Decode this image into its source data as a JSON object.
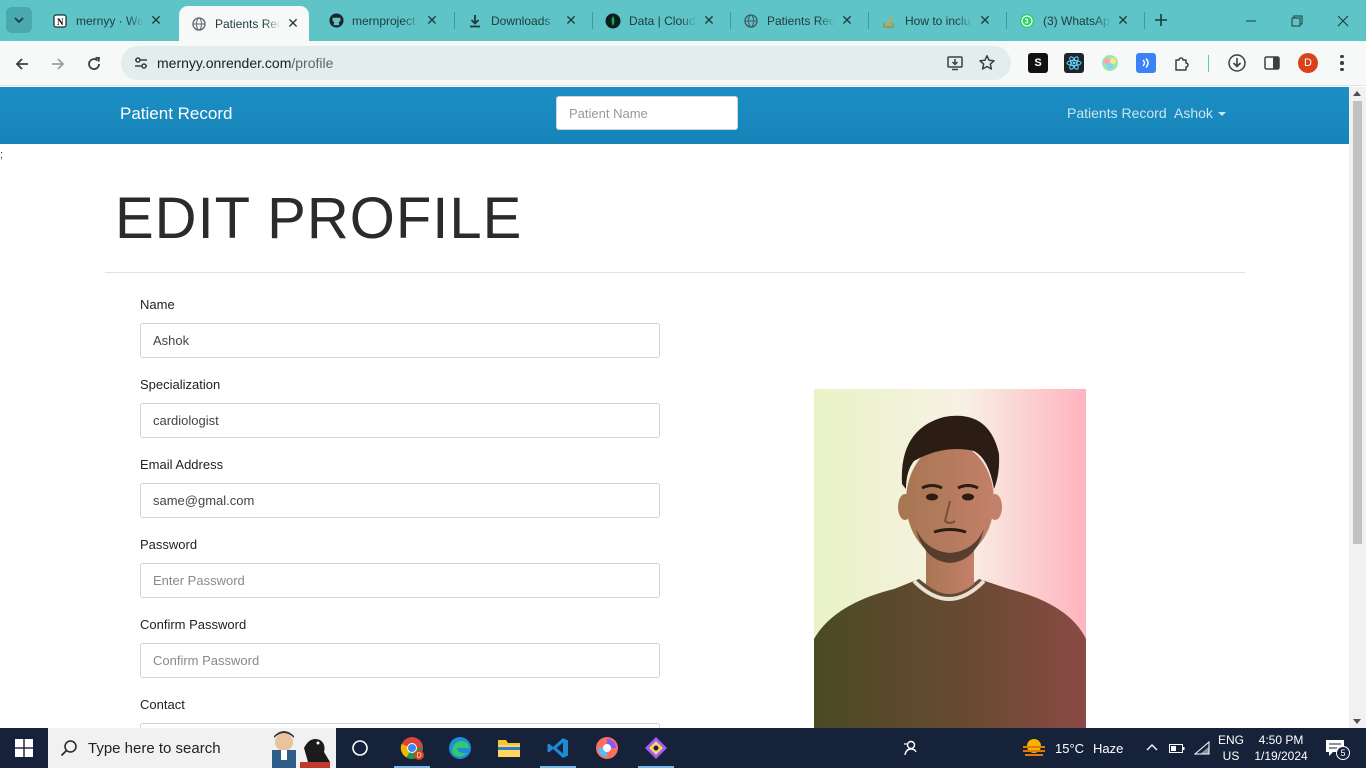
{
  "browser": {
    "tabs": [
      {
        "title": "mernyy · We",
        "icon": "notion-icon"
      },
      {
        "title": "Patients Reco",
        "icon": "globe-icon",
        "active": true
      },
      {
        "title": "mernproject",
        "icon": "github-icon"
      },
      {
        "title": "Downloads",
        "icon": "download-icon"
      },
      {
        "title": "Data | Cloud",
        "icon": "mongodb-leaf-icon"
      },
      {
        "title": "Patients Reco",
        "icon": "globe-icon"
      },
      {
        "title": "How to inclu",
        "icon": "stack-icon"
      },
      {
        "title": "(3) WhatsApp",
        "icon": "whatsapp-icon"
      }
    ],
    "url_host": "mernyy.onrender.com",
    "url_path": "/profile",
    "profile_initial": "D",
    "extension_s_label": "S"
  },
  "navbar": {
    "brand": "Patient Record",
    "search_placeholder": "Patient Name",
    "link_records": "Patients Record",
    "user_menu": "Ashok"
  },
  "stray_text": ";",
  "page": {
    "heading": "EDIT PROFILE"
  },
  "form": {
    "name_label": "Name",
    "name_value": "Ashok",
    "specialization_label": "Specialization",
    "specialization_value": "cardiologist",
    "email_label": "Email Address",
    "email_value": "same@gmal.com",
    "password_label": "Password",
    "password_placeholder": "Enter Password",
    "confirm_label": "Confirm Password",
    "confirm_placeholder": "Confirm Password",
    "contact_label": "Contact"
  },
  "taskbar": {
    "search_label": "Type here to search",
    "weather_temp": "15°C",
    "weather_desc": "Haze",
    "lang_1": "ENG",
    "lang_2": "US",
    "time": "4:50 PM",
    "date": "1/19/2024",
    "notification_count": "5"
  },
  "colors": {
    "tabstrip": "#5ec4c7",
    "navbar": "#1a8bc0",
    "taskbar": "#16213a"
  }
}
